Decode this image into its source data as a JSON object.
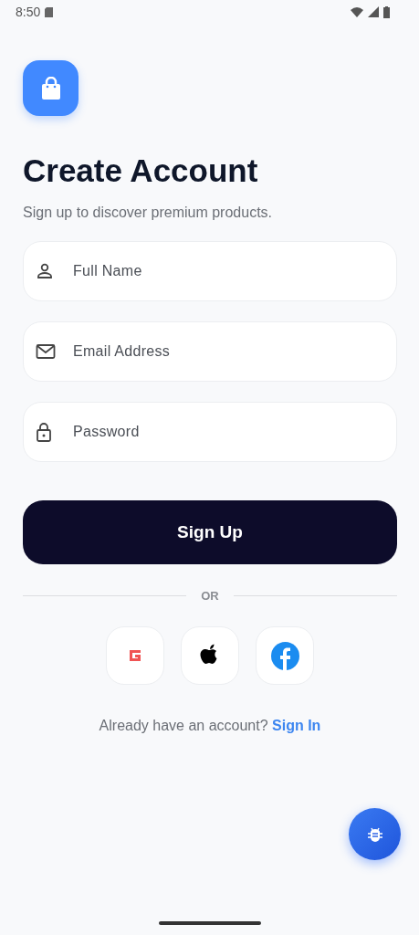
{
  "status_bar": {
    "time": "8:50"
  },
  "title": "Create Account",
  "subtitle": "Sign up to discover premium products.",
  "fields": [
    {
      "kind": "person",
      "placeholder": "Full Name"
    },
    {
      "kind": "email",
      "placeholder": "Email Address"
    },
    {
      "kind": "lock",
      "placeholder": "Password"
    }
  ],
  "primary_button": "Sign Up",
  "divider_label": "OR",
  "social_buttons": [
    {
      "kind": "google"
    },
    {
      "kind": "apple"
    },
    {
      "kind": "facebook"
    }
  ],
  "footer": {
    "text": "Already have an account?",
    "link": "Sign In"
  }
}
